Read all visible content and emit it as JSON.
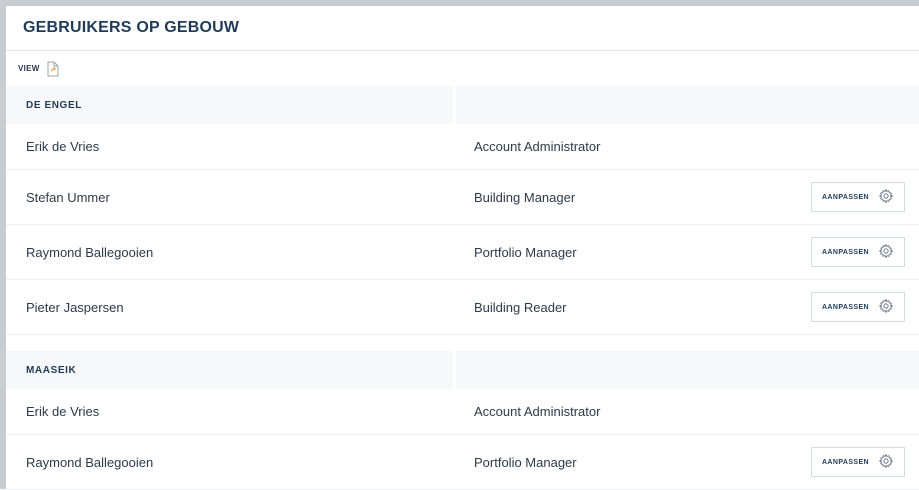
{
  "page": {
    "title": "GEBRUIKERS OP GEBOUW",
    "view_label": "VIEW",
    "edit_label": "AANPASSEN"
  },
  "icons": {
    "export": "document-export-icon",
    "settings": "gear-icon"
  },
  "groups": [
    {
      "name": "DE ENGEL",
      "users": [
        {
          "name": "Erik de Vries",
          "role": "Account Administrator",
          "editable": false
        },
        {
          "name": "Stefan Ummer",
          "role": "Building Manager",
          "editable": true
        },
        {
          "name": "Raymond Ballegooien",
          "role": "Portfolio Manager",
          "editable": true
        },
        {
          "name": "Pieter Jaspersen",
          "role": "Building Reader",
          "editable": true
        }
      ]
    },
    {
      "name": "MAASEIK",
      "users": [
        {
          "name": "Erik de Vries",
          "role": "Account Administrator",
          "editable": false
        },
        {
          "name": "Raymond Ballegooien",
          "role": "Portfolio Manager",
          "editable": true
        }
      ]
    }
  ]
}
